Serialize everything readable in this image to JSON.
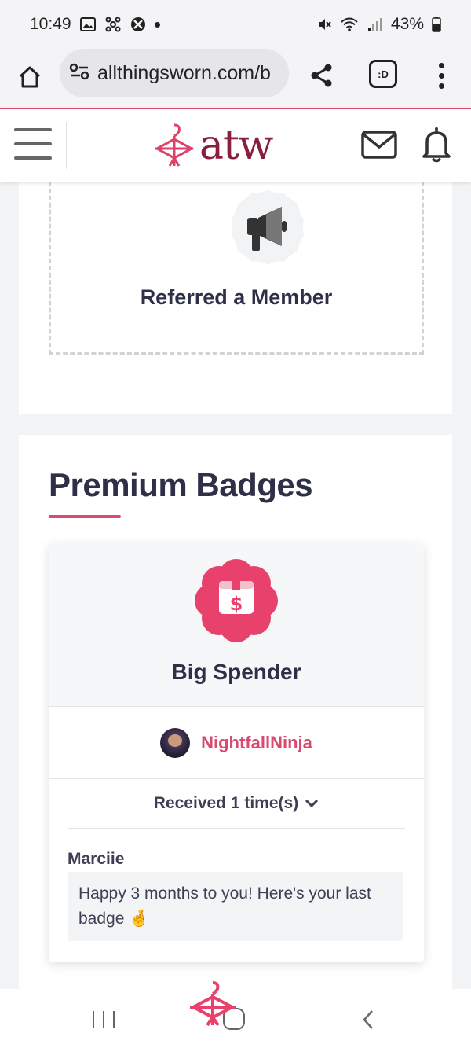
{
  "status_bar": {
    "time": "10:49",
    "battery": "43%"
  },
  "browser": {
    "url": "allthingsworn.com/b",
    "tabs_label": ":D"
  },
  "site": {
    "logo_text": "atw"
  },
  "badge_card": {
    "title": "Referred a Member",
    "icon": "megaphone-icon"
  },
  "premium": {
    "section_title": "Premium Badges",
    "badge": {
      "name": "Big Spender",
      "icon": "gift-box-dollar-icon"
    },
    "user": {
      "username": "NightfallNinja"
    },
    "received_label": "Received 1 time(s)",
    "giver": "Marciie",
    "message": "Happy 3 months to you! Here's your last badge 🤞"
  },
  "colors": {
    "accent": "#d84a6e",
    "brand": "#8a1f3d",
    "text": "#2e3047"
  }
}
